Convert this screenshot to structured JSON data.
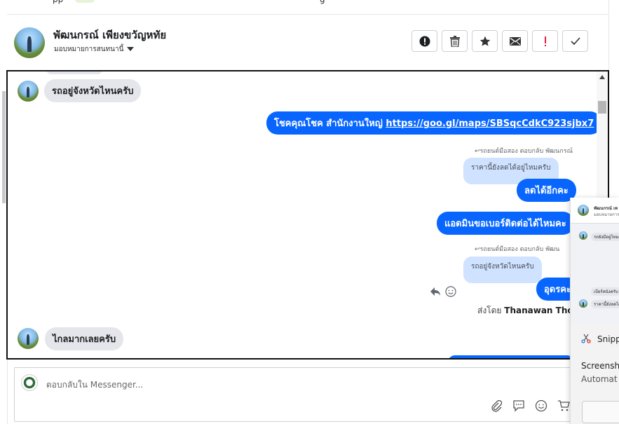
{
  "top_fragment_left": "pp",
  "top_fragment_right": "g",
  "header": {
    "name": "พัฒนกรณ์ เพียงขวัญหทัย",
    "assign_label": "มอบหมายการสนทนานี้",
    "actions": [
      {
        "label": "Spam",
        "icon": "alert-circle-icon"
      },
      {
        "label": "Delete",
        "icon": "trash-icon"
      },
      {
        "label": "Follow up",
        "icon": "star-icon"
      },
      {
        "label": "Mark as unread",
        "icon": "envelope-icon"
      },
      {
        "label": "Priority",
        "icon": "exclamation-icon"
      },
      {
        "label": "Done",
        "icon": "checkmark-icon"
      }
    ]
  },
  "messages": {
    "m1": "รถอยู่จังหวัดไหนครับ",
    "m2_prefix": "โชคคุณโชค สำนักงานใหญ่",
    "m2_link": "https://goo.gl/maps/SBSqcCdkC923sjbx7",
    "m3_reply_label": "รถยนต์มือสอง ตอบกลับ พัฒนกรณ์",
    "m3_quote": "ราคานี้ยังลดได้อยู่ไหมครับ",
    "m3": "ลดได้อีกคะ",
    "m4": "แอดมินขอเบอร์ติดต่อได้ไหมคะ",
    "m5_reply_label": "รถยนต์มือสอง ตอบกลับ พัฒน",
    "m5_quote": "รถอยู่จังหวัดไหนครับ",
    "m5": "อุดรคะ",
    "sent_by_prefix": "ส่งโดย",
    "sent_by_name": "Thanawan Thon",
    "m6": "ไกลมากเลยครับ"
  },
  "composer": {
    "placeholder": "ตอบกลับใน Messenger...",
    "tools": [
      "attach-icon",
      "saved-reply-icon",
      "emoji-icon",
      "cart-icon"
    ]
  },
  "overlay": {
    "thumb_header": "พัฒนกรณ์ เพ",
    "thumb_sub": "มอบหมายการสนทนานี้",
    "thumb_msg1": "รถยังมีอยู่ไหมครับ",
    "thumb_msg2": "เบียร์หนังครับ",
    "thumb_msg3": "ราคานี้ยังลดได้",
    "snip_title": "Snipp",
    "notif_line1": "Screensh",
    "notif_line2": "Automat"
  }
}
